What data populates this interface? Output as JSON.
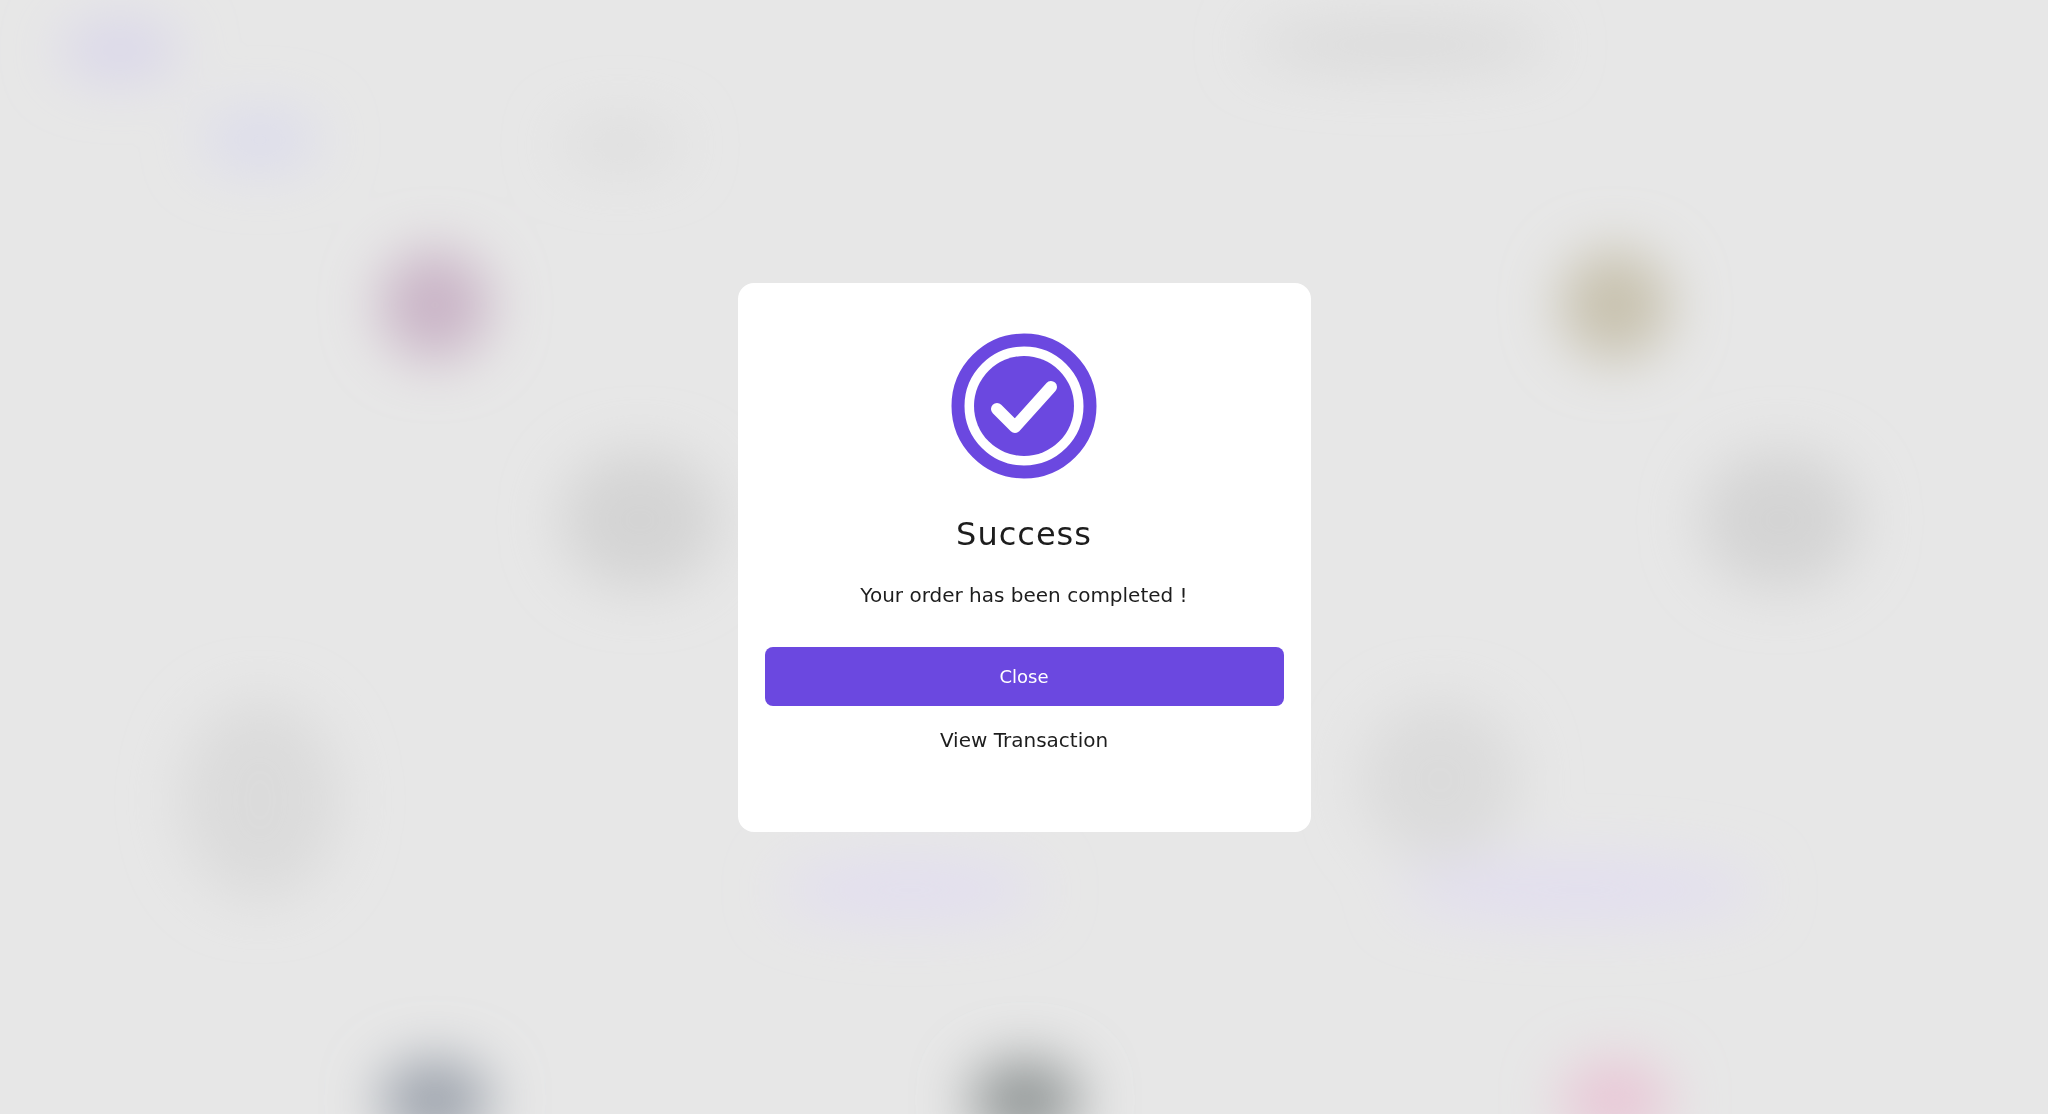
{
  "dialog": {
    "title": "Success",
    "message": "Your order has been completed !",
    "actions": [
      {
        "label": "Close",
        "kind": "primary"
      },
      {
        "label": "View Transaction",
        "kind": "link"
      }
    ]
  }
}
